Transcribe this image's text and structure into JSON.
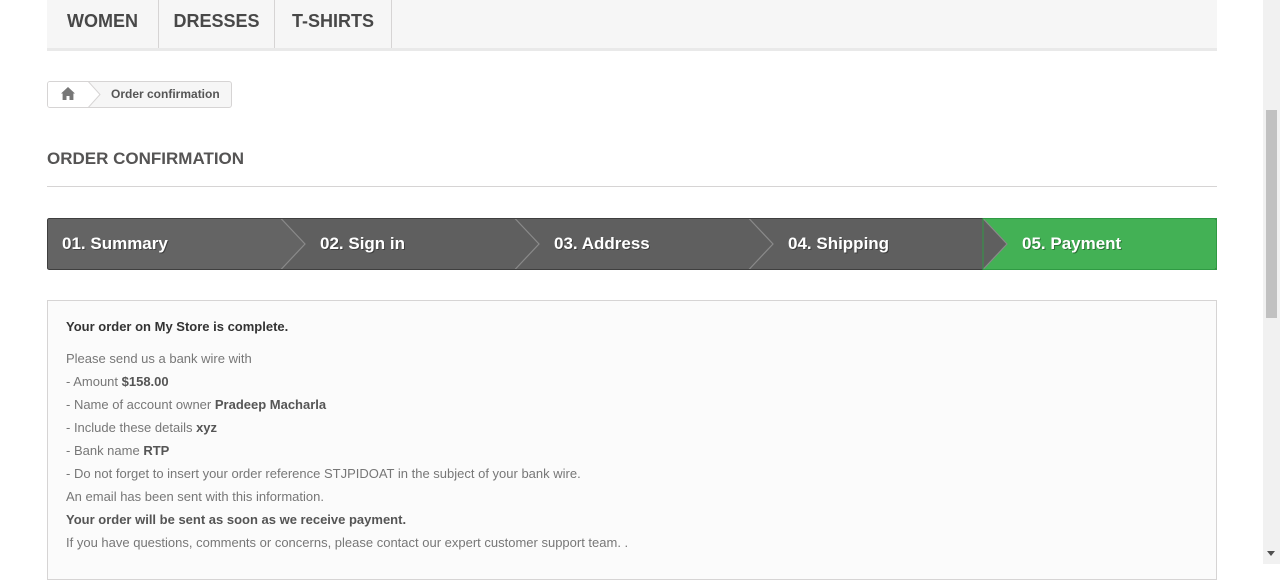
{
  "nav": {
    "items": [
      {
        "label": "Women"
      },
      {
        "label": "Dresses"
      },
      {
        "label": "T-shirts"
      }
    ]
  },
  "breadcrumb": {
    "home_icon": "home-icon",
    "current": "Order confirmation"
  },
  "page_heading": "Order confirmation",
  "steps": [
    {
      "label": "01. Summary",
      "state": "done"
    },
    {
      "label": "02. Sign in",
      "state": "done"
    },
    {
      "label": "03. Address",
      "state": "done"
    },
    {
      "label": "04. Shipping",
      "state": "done"
    },
    {
      "label": "05. Payment",
      "state": "current"
    }
  ],
  "colors": {
    "step_done": "#5b5b5b",
    "step_current": "#43b155"
  },
  "confirmation": {
    "complete_prefix": "Your order on ",
    "store_name": "My Store",
    "complete_suffix": " is complete.",
    "intro": "Please send us a bank wire with",
    "amount_label": "- Amount ",
    "amount_value": "$158.00",
    "owner_label": "- Name of account owner ",
    "owner_value": "Pradeep Macharla",
    "details_label": "- Include these details ",
    "details_value": "xyz",
    "bank_label": "- Bank name ",
    "bank_value": "RTP",
    "reference_text": "- Do not forget to insert your order reference STJPIDOAT in the subject of your bank wire.",
    "email_text": "An email has been sent with this information.",
    "sent_text": "Your order will be sent as soon as we receive payment.",
    "questions_text": "If you have questions, comments or concerns, please contact our expert customer support team. ."
  }
}
